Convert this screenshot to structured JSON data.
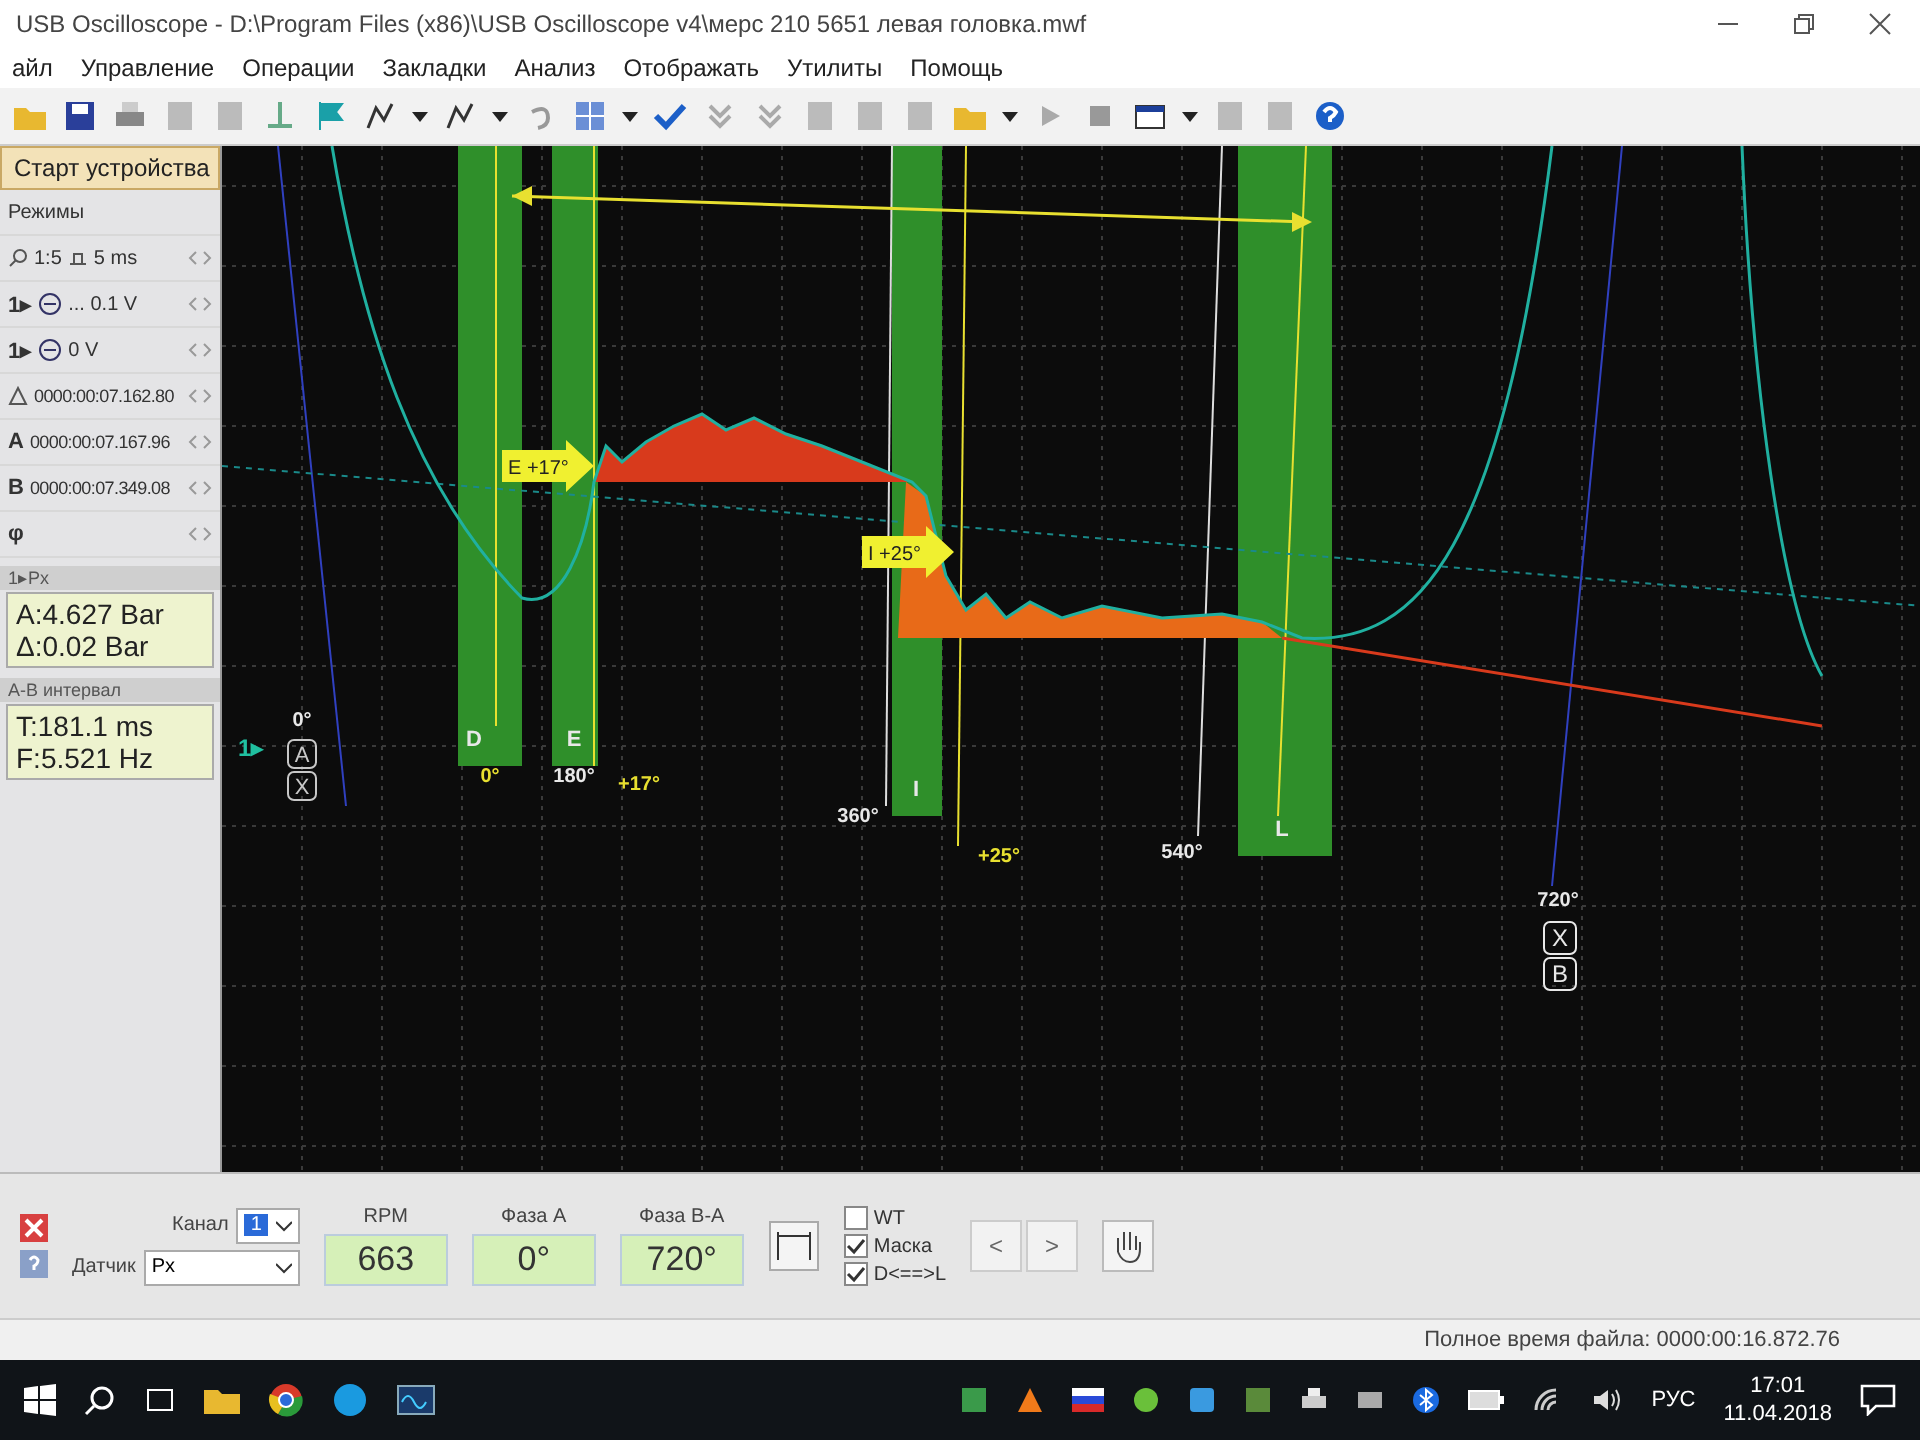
{
  "window": {
    "title": "USB Oscilloscope - D:\\Program Files (x86)\\USB Oscilloscope v4\\мерс 210 5651 левая головка.mwf"
  },
  "menu": [
    "айл",
    "Управление",
    "Операции",
    "Закладки",
    "Анализ",
    "Отображать",
    "Утилиты",
    "Помощь"
  ],
  "left_panel": {
    "start_button": "Старт устройства",
    "modes": "Режимы",
    "rows": [
      {
        "kind": "scale",
        "text": "1:5",
        "text2": "5 ms"
      },
      {
        "kind": "channel",
        "prefix": "1▸",
        "text": "... 0.1 V"
      },
      {
        "kind": "trigger",
        "prefix": "1▸",
        "text": "0 V"
      },
      {
        "kind": "delta",
        "text": "0000:00:07.162.80"
      },
      {
        "kind": "cursor",
        "prefix": "A",
        "text": "0000:00:07.167.96"
      },
      {
        "kind": "cursor",
        "prefix": "B",
        "text": "0000:00:07.349.08"
      },
      {
        "kind": "phase",
        "prefix": "φ"
      }
    ],
    "readouts": [
      {
        "header": "1▸Px",
        "lines": [
          "A:4.627 Bar",
          "Δ:0.02 Bar"
        ]
      },
      {
        "header": "A-B интервал",
        "lines": [
          "T:181.1 ms",
          "F:5.521 Hz"
        ]
      }
    ]
  },
  "scope": {
    "channel_label": "1▸",
    "origin_label": "0°",
    "cursor_labels": [
      "A",
      "X"
    ],
    "zones": [
      {
        "label": "D"
      },
      {
        "label": "E"
      },
      {
        "label": "I"
      },
      {
        "label": "L"
      }
    ],
    "angle_labels": [
      "0°",
      "180°",
      "360°",
      "540°",
      "720°"
    ],
    "offset_labels": [
      "+17°",
      "+25°"
    ],
    "timing_flags": [
      "E +17°",
      "I +25°"
    ],
    "end_cursor_labels": [
      "X",
      "B"
    ]
  },
  "controls": {
    "sensor_label": "Датчик",
    "sensor_value": "Px",
    "channel_label": "Канал",
    "channel_value": "1",
    "readings": [
      {
        "label": "RPM",
        "value": "663"
      },
      {
        "label": "Фаза A",
        "value": "0°"
      },
      {
        "label": "Фаза B-A",
        "value": "720°"
      }
    ],
    "checkboxes": [
      {
        "label": "WT",
        "checked": false
      },
      {
        "label": "Маска",
        "checked": true
      },
      {
        "label": "D<==>L",
        "checked": true
      }
    ],
    "nav_buttons": [
      "<",
      ">"
    ]
  },
  "status_bar": "Полное время файла: 0000:00:16.872.76",
  "taskbar": {
    "language": "РУС",
    "time": "17:01",
    "date": "11.04.2018"
  }
}
